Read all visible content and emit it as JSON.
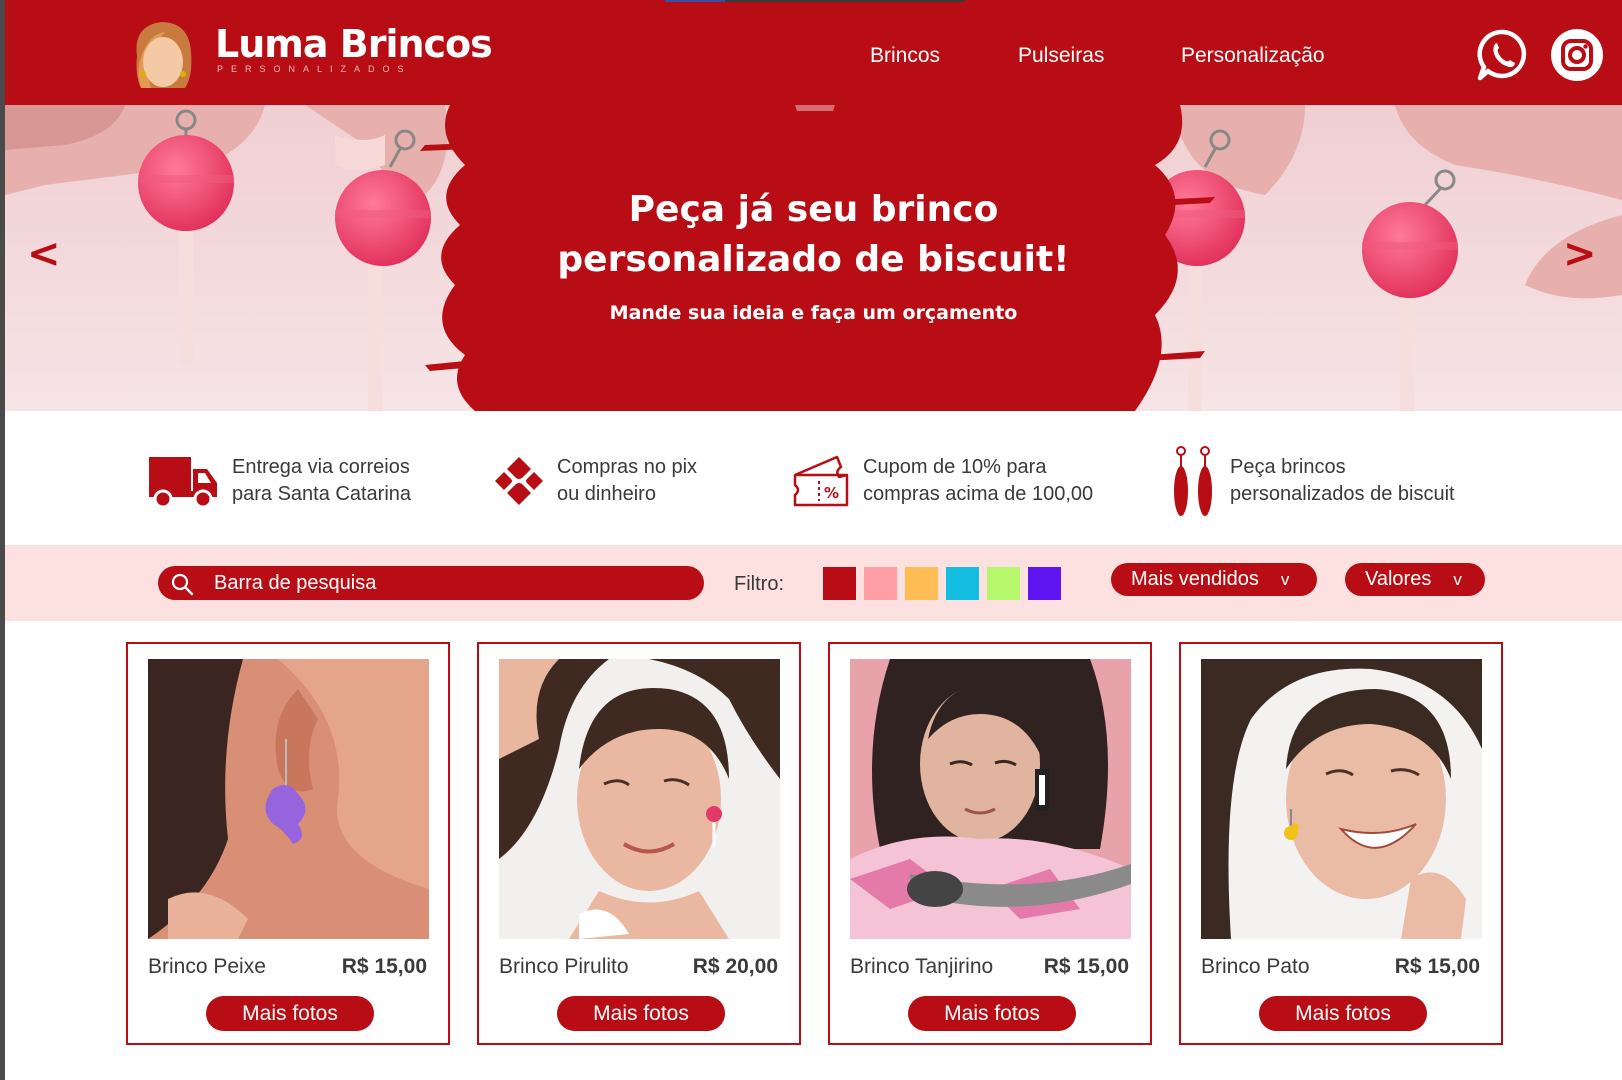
{
  "header": {
    "brand_name": "Luma Brincos",
    "brand_tagline": "PERSONALIZADOS",
    "nav": [
      "Brincos",
      "Pulseiras",
      "Personalização"
    ],
    "social_icons": [
      "whatsapp-icon",
      "instagram-icon"
    ]
  },
  "banner": {
    "title_line1": "Peça já seu brinco",
    "title_line2": "personalizado de biscuit!",
    "subtitle": "Mande sua ideia e faça um orçamento",
    "prev": "<",
    "next": ">"
  },
  "features": [
    {
      "icon": "truck-icon",
      "line1": "Entrega via correios",
      "line2": "para Santa Catarina"
    },
    {
      "icon": "pix-icon",
      "line1": "Compras no pix",
      "line2": "ou dinheiro"
    },
    {
      "icon": "coupon-icon",
      "line1": "Cupom de 10% para",
      "line2": "compras acima de 100,00"
    },
    {
      "icon": "earrings-icon",
      "line1": "Peça brincos",
      "line2": "personalizados de biscuit"
    }
  ],
  "toolbar": {
    "search_placeholder": "Barra de pesquisa",
    "filter_label": "Filtro:",
    "filter_colors": [
      "#b80d14",
      "#ff9ea5",
      "#ffbe55",
      "#12bde0",
      "#b6f76b",
      "#5f14f2"
    ],
    "sort_label": "Mais vendidos",
    "values_label": "Valores",
    "chevron": "v"
  },
  "products": [
    {
      "name": "Brinco Peixe",
      "price": "R$ 15,00",
      "button": "Mais fotos"
    },
    {
      "name": "Brinco Pirulito",
      "price": "R$ 20,00",
      "button": "Mais fotos"
    },
    {
      "name": "Brinco Tanjirino",
      "price": "R$ 15,00",
      "button": "Mais fotos"
    },
    {
      "name": "Brinco Pato",
      "price": "R$ 15,00",
      "button": "Mais fotos"
    }
  ],
  "colors": {
    "brand": "#b80d14",
    "toolbar_bg": "#fde0e0"
  }
}
